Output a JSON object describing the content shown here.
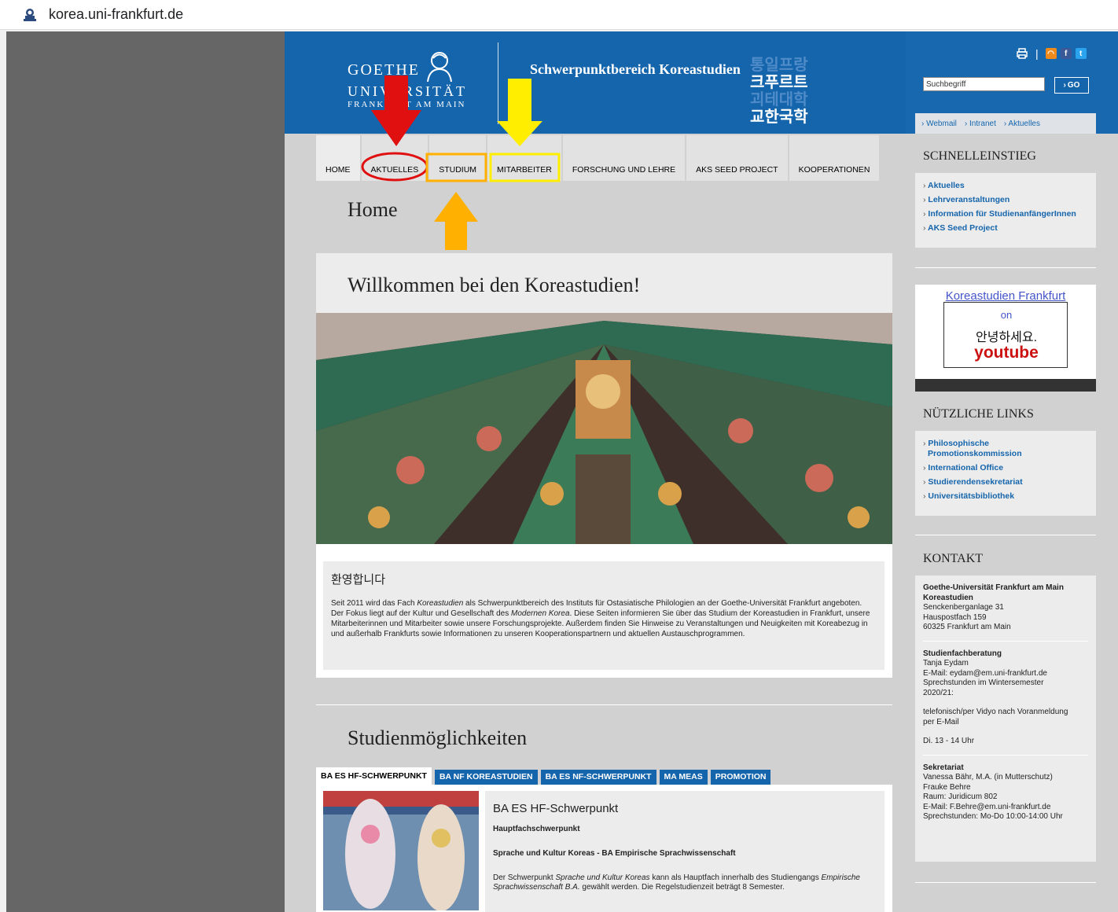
{
  "browser": {
    "url": "korea.uni-frankfurt.de"
  },
  "header": {
    "logo_goethe": "GOETHE",
    "logo_uni": "UNIVERSITÄT",
    "logo_fra": "FRANKFURT AM MAIN",
    "title": "Schwerpunktbereich Koreastudien",
    "korean_lines": [
      "통일프랑",
      "크푸르트",
      "괴테대학",
      "교한국학"
    ],
    "search_placeholder": "Suchbegriff",
    "go_label": "GO",
    "quick_links": [
      "Webmail",
      "Intranet",
      "Aktuelles"
    ]
  },
  "nav": {
    "tabs": [
      "HOME",
      "AKTUELLES",
      "STUDIUM",
      "MITARBEITER",
      "FORSCHUNG UND LEHRE",
      "AKS SEED PROJECT",
      "KOOPERATIONEN"
    ]
  },
  "main": {
    "page_title": "Home",
    "welcome_title": "Willkommen bei den Koreastudien!",
    "intro_heading": "환영합니다",
    "intro_p1": "Seit 2011 wird das Fach ",
    "intro_em1": "Koreastudien",
    "intro_p2": " als Schwerpunktbereich des Instituts für Ostasiatische Philologien an der Goethe-Universität Frankfurt angeboten. Der Fokus liegt auf der Kultur und Gesellschaft des ",
    "intro_em2": "Modernen Korea",
    "intro_p3": ". Diese Seiten informieren Sie über das Studium der Koreastudien in Frankfurt, unsere Mitarbeiterinnen und Mitarbeiter sowie unsere Forschungsprojekte. Außerdem finden Sie Hinweise zu Veranstaltungen und Neuigkeiten mit Koreabezug in und außerhalb Frankfurts sowie Informationen zu unseren Kooperationspartnern und aktuellen Austauschprogrammen.",
    "studien_title": "Studienmöglichkeiten",
    "subtabs": [
      "BA ES HF-SCHWERPUNKT",
      "BA NF KOREASTUDIEN",
      "BA ES NF-SCHWERPUNKT",
      "MA MEAS",
      "PROMOTION"
    ],
    "panel_heading": "BA ES HF-Schwerpunkt",
    "panel_sub1": "Hauptfachschwerpunkt",
    "panel_sub2": "Sprache und Kultur Koreas - BA Empirische Sprachwissenschaft",
    "panel_p1": "Der Schwerpunkt ",
    "panel_em1": "Sprache und Kultur Koreas",
    "panel_p2": " kann als Hauptfach innerhalb des Studiengangs ",
    "panel_em2": "Empirische Sprachwissenschaft B.A.",
    "panel_p3": " gewählt werden. Die Regelstudienzeit beträgt 8 Semester."
  },
  "sidebar": {
    "schnell_title": "SCHNELLEINSTIEG",
    "schnell_links": [
      "Aktuelles",
      "Lehrveranstaltungen",
      "Information für StudienanfängerInnen",
      "AKS Seed Project"
    ],
    "youtube_title": "Koreastudien Frankfurt",
    "youtube_on": "on",
    "youtube_ko": "안녕하세요.",
    "youtube_word": "youtube",
    "links_title": "NÜTZLICHE LINKS",
    "links": [
      "Philosophische",
      "Promotionskommission",
      "International Office",
      "Studierendensekretariat",
      "Universitätsbibliothek"
    ],
    "kontakt_title": "KONTAKT",
    "kontakt": {
      "org1": "Goethe-Universität Frankfurt am Main",
      "org2": "Koreastudien",
      "addr1": "Senckenberganlage 31",
      "addr2": "Hauspostfach 159",
      "addr3": "60325 Frankfurt am Main",
      "sfb_title": "Studienfachberatung",
      "sfb_name": "Tanja Eydam",
      "sfb_mail": "E-Mail: eydam@em.uni-frankfurt.de",
      "sfb_hours1": "Sprechstunden im Wintersemester",
      "sfb_hours2": "2020/21:",
      "sfb_tel1": "telefonisch/per Vidyo nach Voranmeldung",
      "sfb_tel2": "per E-Mail",
      "sfb_time": "Di. 13 - 14 Uhr",
      "sek_title": "Sekretariat",
      "sek_1": "Vanessa Bähr, M.A. (in Mutterschutz)",
      "sek_2": "Frauke Behre",
      "sek_3": "Raum: Juridicum 802",
      "sek_4": "E-Mail: F.Behre@em.uni-frankfurt.de",
      "sek_5": "Sprechstunden: Mo-Do 10:00-14:00 Uhr"
    }
  },
  "colors": {
    "brand_blue": "#1565ac",
    "annotation_red": "#e01010",
    "annotation_orange": "#ffb000",
    "annotation_yellow": "#ffee00"
  }
}
